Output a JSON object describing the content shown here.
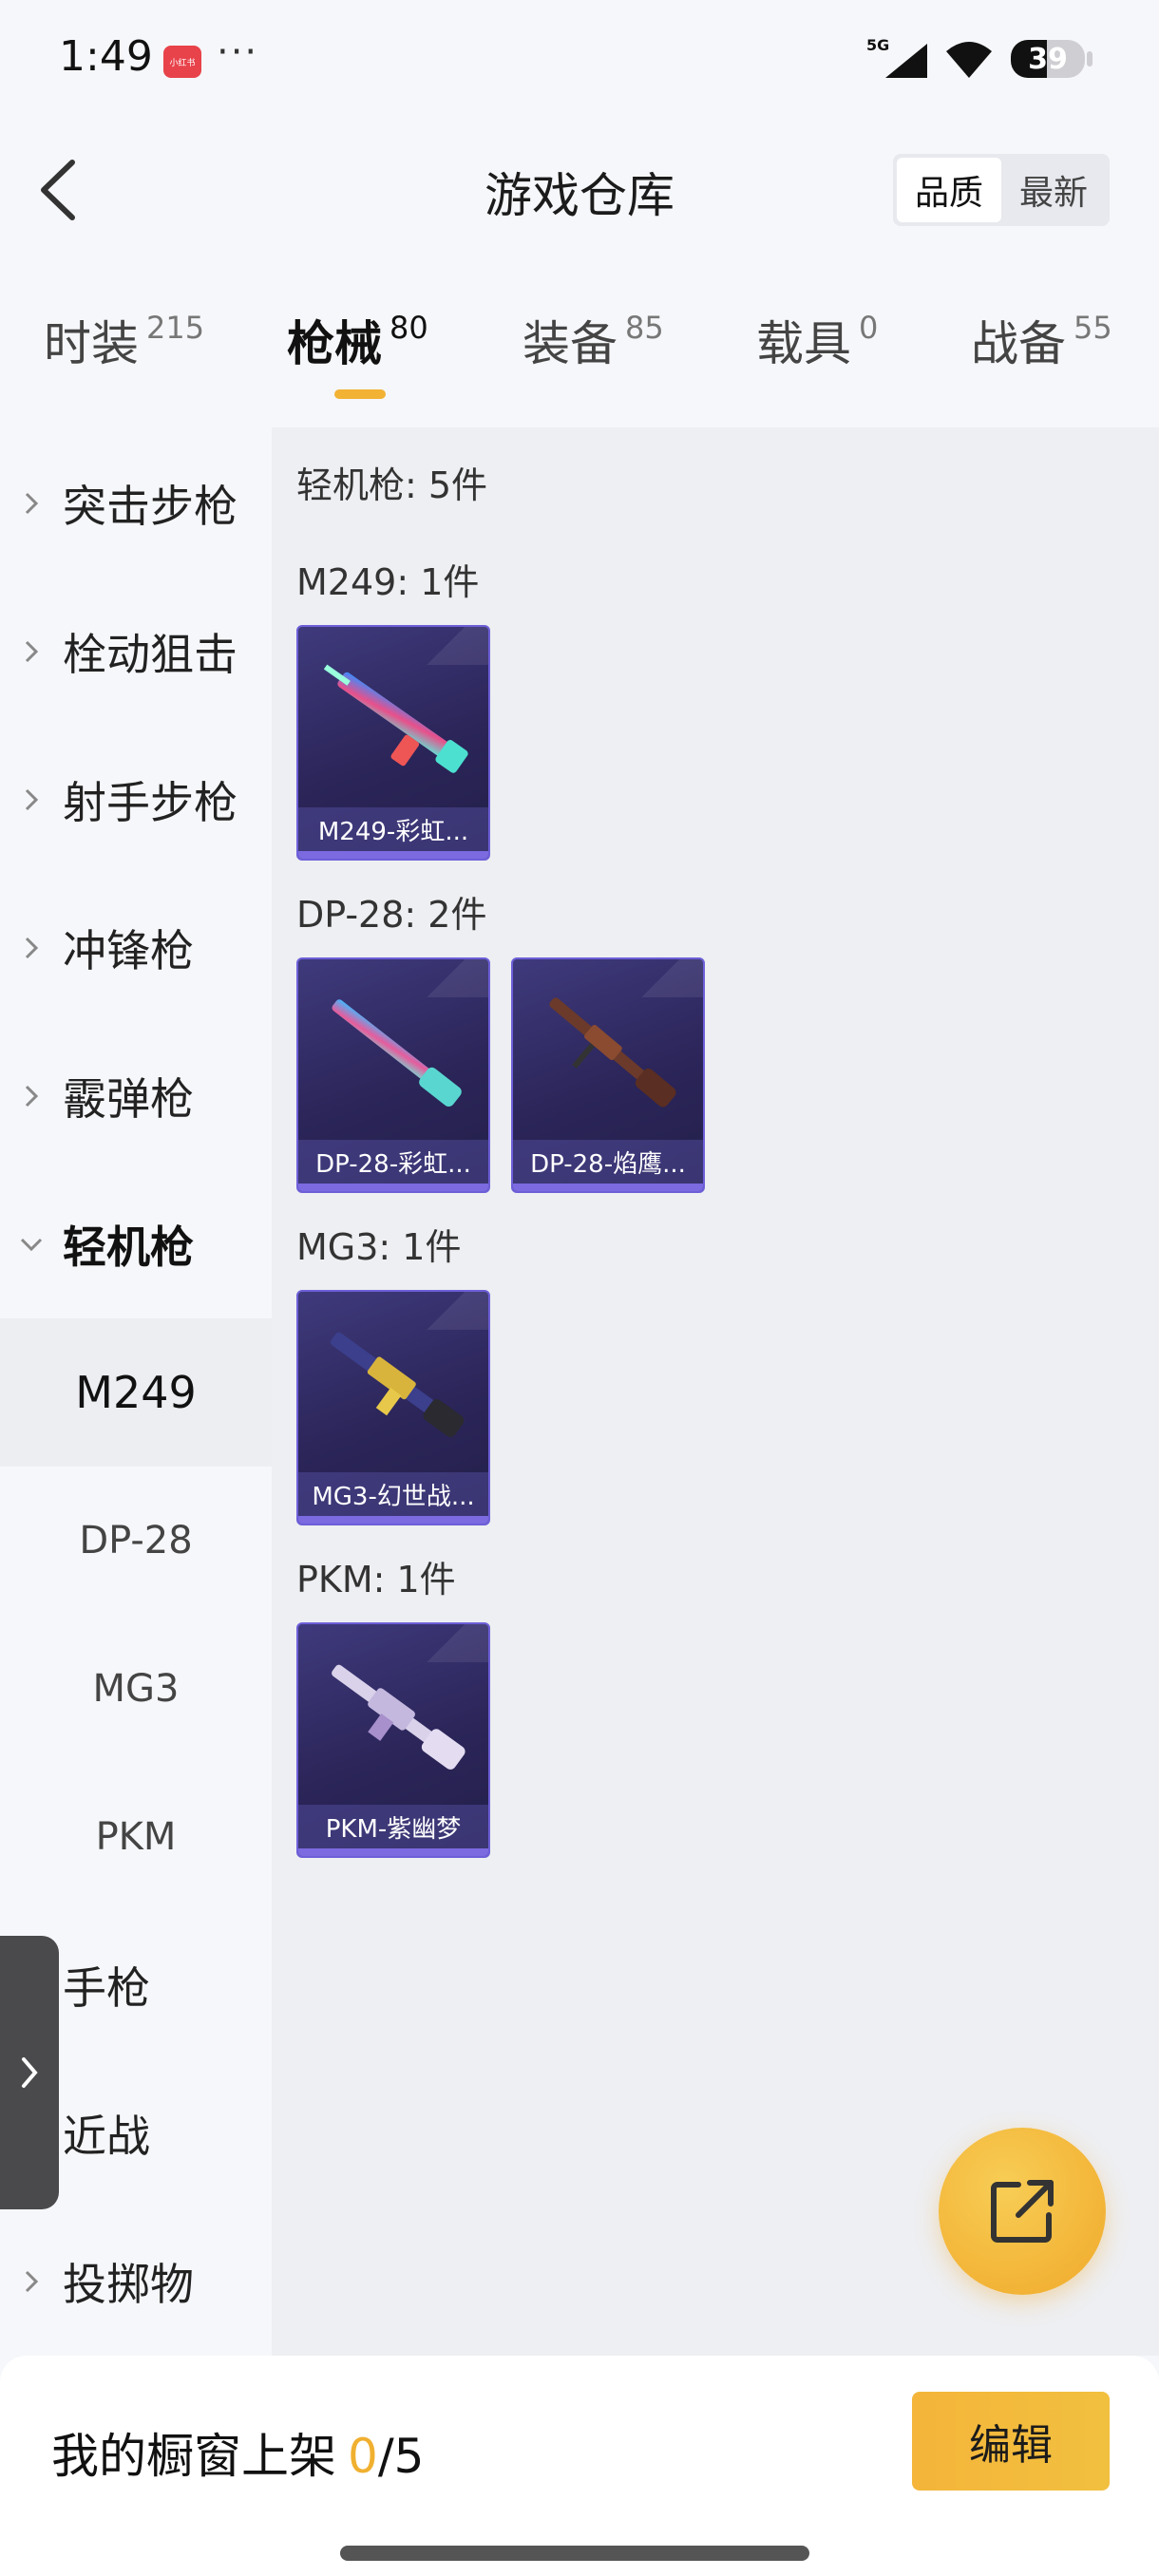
{
  "status": {
    "time": "1:49",
    "app_badge": "小红书",
    "more": "···",
    "network": "5G",
    "battery": "39"
  },
  "header": {
    "title": "游戏仓库",
    "sort": [
      "品质",
      "最新"
    ],
    "sort_active": 0
  },
  "tabs": [
    {
      "label": "时装",
      "count": "215"
    },
    {
      "label": "枪械",
      "count": "80"
    },
    {
      "label": "装备",
      "count": "85"
    },
    {
      "label": "载具",
      "count": "0"
    },
    {
      "label": "战备",
      "count": "55"
    }
  ],
  "active_tab": 1,
  "sidebar": {
    "items": [
      "突击步枪",
      "栓动狙击",
      "射手步枪",
      "冲锋枪",
      "霰弹枪",
      "轻机枪",
      "手枪",
      "近战",
      "投掷物"
    ],
    "sub_items": [
      "M249",
      "DP-28",
      "MG3",
      "PKM"
    ],
    "selected_sub": "M249"
  },
  "content": {
    "category_title": "轻机枪: 5件",
    "groups": [
      {
        "title": "M249: 1件",
        "items": [
          "M249-彩虹..."
        ]
      },
      {
        "title": "DP-28: 2件",
        "items": [
          "DP-28-彩虹...",
          "DP-28-焰鹰..."
        ]
      },
      {
        "title": "MG3: 1件",
        "items": [
          "MG3-幻世战..."
        ]
      },
      {
        "title": "PKM: 1件",
        "items": [
          "PKM-紫幽梦"
        ]
      }
    ]
  },
  "bottom": {
    "label": "我的橱窗上架",
    "current": "0",
    "total": "/5",
    "edit": "编辑"
  },
  "colors": {
    "accent": "#f0b030",
    "card_bg": "#2b2559",
    "card_border": "#6d5fd8"
  }
}
